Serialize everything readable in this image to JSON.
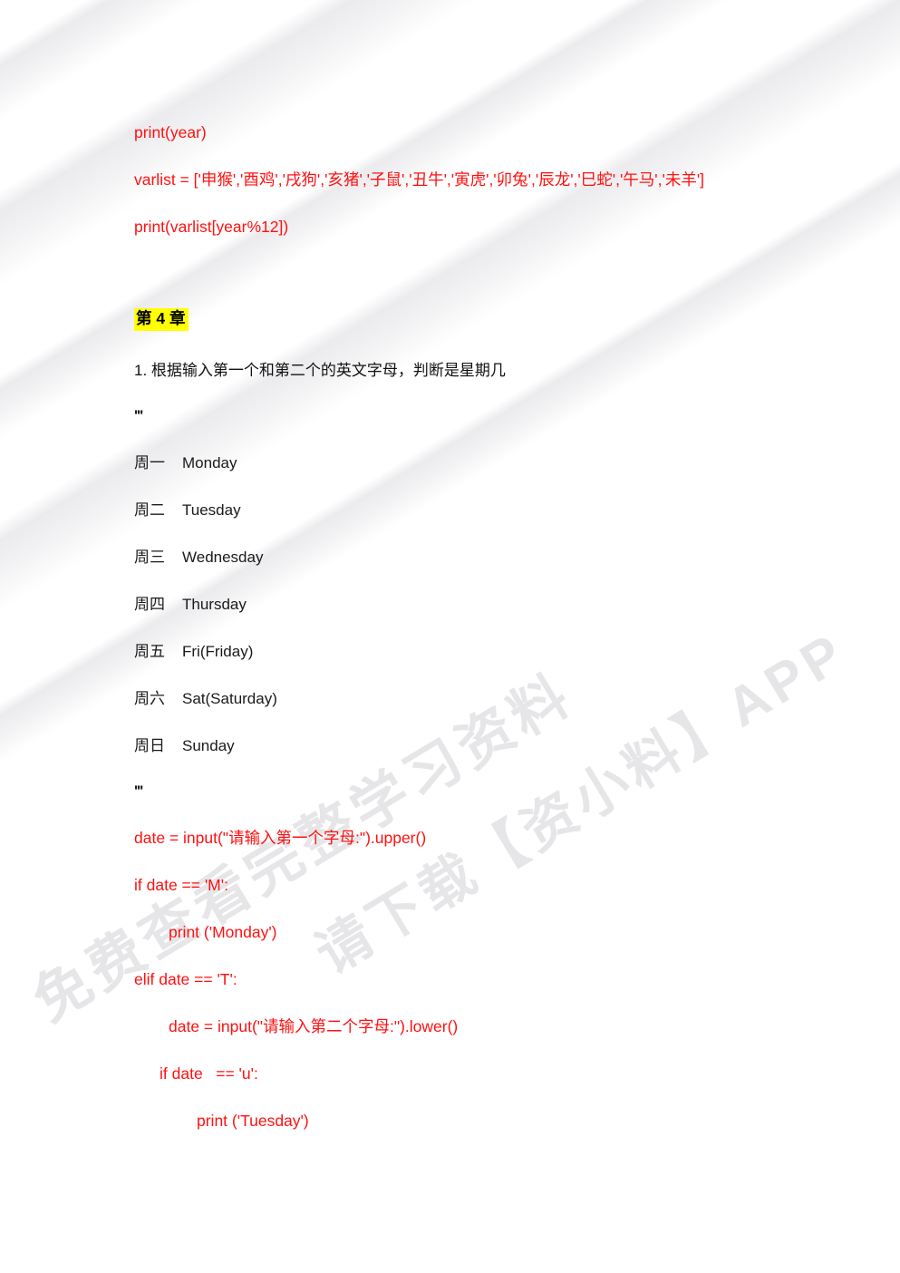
{
  "document": {
    "background_color": "#ffffff",
    "code_color": "#ff1111",
    "text_color": "#1a1a1a",
    "highlight_color": "#ffff00"
  },
  "watermark": {
    "line1": "免费查看完整学习资料",
    "line2": "请下载【资小料】APP"
  },
  "code_top": [
    {
      "text": "print(year)",
      "indent": 0
    },
    {
      "text": "varlist = ['申猴','酉鸡','戌狗','亥猪','子鼠','丑牛','寅虎','卯兔','辰龙','巳蛇','午马','未羊']",
      "indent": 0
    },
    {
      "text": "print(varlist[year%12])",
      "indent": 0
    }
  ],
  "chapter": {
    "heading": "第 4 章",
    "task_number_title": "1. 根据输入第一个和第二个的英文字母，判断是星期几"
  },
  "docstring": {
    "open": "'''",
    "close": "'''"
  },
  "weekdays": [
    {
      "cn": "周一",
      "en": "Monday"
    },
    {
      "cn": "周二",
      "en": "Tuesday"
    },
    {
      "cn": "周三",
      "en": "Wednesday"
    },
    {
      "cn": "周四",
      "en": "Thursday"
    },
    {
      "cn": "周五",
      "en": "Fri(Friday)"
    },
    {
      "cn": "周六",
      "en": "Sat(Saturday)"
    },
    {
      "cn": "周日",
      "en": "Sunday"
    }
  ],
  "code_bottom": [
    {
      "text": "date = input(\"请输入第一个字母:\").upper()",
      "indent": 0
    },
    {
      "text": "if date == 'M':",
      "indent": 0
    },
    {
      "text": "print ('Monday')",
      "indent": 1
    },
    {
      "text": "elif date == 'T':",
      "indent": 0
    },
    {
      "text": "date = input(\"请输入第二个字母:\").lower()",
      "indent": 1
    },
    {
      "text": "if date   == 'u':",
      "indent": 1
    },
    {
      "text": "print ('Tuesday')",
      "indent": 2
    }
  ]
}
